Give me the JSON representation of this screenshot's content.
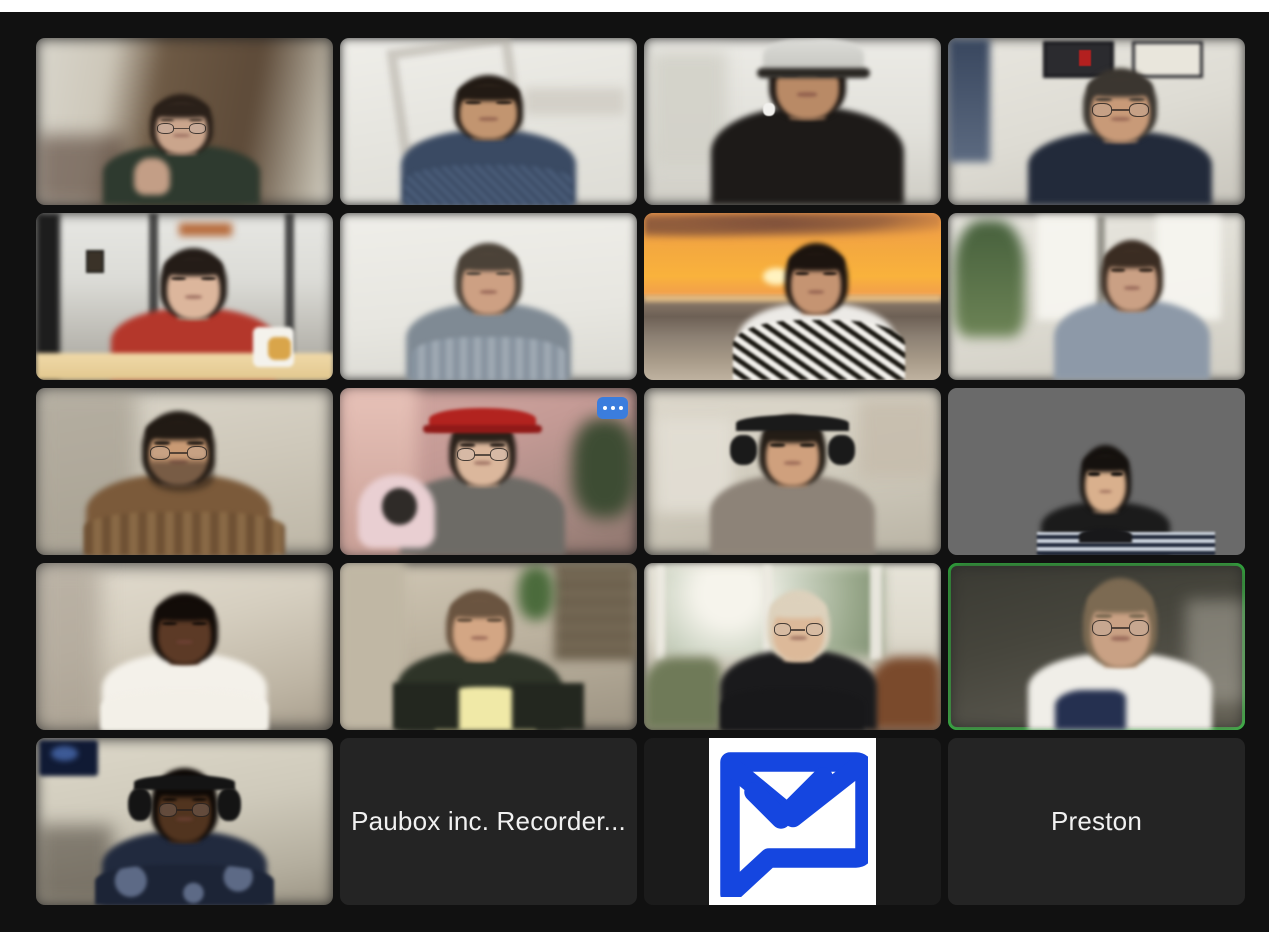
{
  "app": {
    "title": "Video Meeting Gallery View",
    "background_color": "#111111",
    "tile_color": "#242424",
    "active_speaker_color": "#22e03c",
    "brand_blue": "#1546e0",
    "more_button_color": "#3b7ddd"
  },
  "controls": {
    "more_options_label": "More options",
    "more_options_icon": "ellipsis-horizontal-icon"
  },
  "logo": {
    "name": "paubox-logo",
    "alt": "Paubox envelope checkmark logo",
    "color": "#1546e0",
    "background": "#ffffff"
  },
  "grid": {
    "columns": 4,
    "rows": 5,
    "tiles": [
      {
        "id": "p1",
        "type": "video",
        "name": "participant-tile-1",
        "label": "",
        "scene": "woman-glasses-brick-wall",
        "active": false,
        "more_menu": false
      },
      {
        "id": "p2",
        "type": "video",
        "name": "participant-tile-2",
        "label": "",
        "scene": "man-patterned-shirt-white-room",
        "active": false,
        "more_menu": false
      },
      {
        "id": "p3",
        "type": "video",
        "name": "participant-tile-3",
        "label": "",
        "scene": "man-cap-earbuds-bright-room",
        "active": false,
        "more_menu": false
      },
      {
        "id": "p4",
        "type": "video",
        "name": "participant-tile-4",
        "label": "",
        "scene": "man-glasses-home-office-frames",
        "active": false,
        "more_menu": false
      },
      {
        "id": "p5",
        "type": "video",
        "name": "participant-tile-5",
        "label": "",
        "scene": "man-red-shirt-open-office-mug",
        "active": false,
        "more_menu": false
      },
      {
        "id": "p6",
        "type": "video",
        "name": "participant-tile-6",
        "label": "",
        "scene": "man-checked-shirt-white-wall",
        "active": false,
        "more_menu": false
      },
      {
        "id": "p7",
        "type": "video",
        "name": "participant-tile-7",
        "label": "",
        "scene": "woman-sunset-beach-background",
        "active": false,
        "more_menu": false
      },
      {
        "id": "p8",
        "type": "video",
        "name": "participant-tile-8",
        "label": "",
        "scene": "woman-sunroom-plants-window",
        "active": false,
        "more_menu": false
      },
      {
        "id": "p9",
        "type": "video",
        "name": "participant-tile-9",
        "label": "",
        "scene": "man-glasses-beard-plaid-shirt",
        "active": false,
        "more_menu": false
      },
      {
        "id": "p10",
        "type": "video",
        "name": "participant-tile-10",
        "label": "",
        "scene": "man-red-cap-microphone-pink-wall",
        "active": false,
        "more_menu": true
      },
      {
        "id": "p11",
        "type": "video",
        "name": "participant-tile-11",
        "label": "",
        "scene": "man-headphones-living-room",
        "active": false,
        "more_menu": false
      },
      {
        "id": "p12",
        "type": "video",
        "name": "participant-tile-12",
        "label": "",
        "scene": "woman-striped-top-gray-backdrop",
        "active": false,
        "more_menu": false
      },
      {
        "id": "p13",
        "type": "video",
        "name": "participant-tile-13",
        "label": "",
        "scene": "man-white-tee-warm-room",
        "active": false,
        "more_menu": false
      },
      {
        "id": "p14",
        "type": "video",
        "name": "participant-tile-14",
        "label": "",
        "scene": "man-yellow-shirt-bookshelf",
        "active": false,
        "more_menu": false
      },
      {
        "id": "p15",
        "type": "video",
        "name": "participant-tile-15",
        "label": "",
        "scene": "woman-glasses-garden-window",
        "active": false,
        "more_menu": false
      },
      {
        "id": "p16",
        "type": "video",
        "name": "participant-tile-16",
        "label": "",
        "scene": "woman-glasses-dark-room-speaking",
        "active": true,
        "more_menu": false
      },
      {
        "id": "p17",
        "type": "video",
        "name": "participant-tile-17",
        "label": "",
        "scene": "man-headset-glasses-floral-shirt",
        "active": false,
        "more_menu": false
      },
      {
        "id": "p18",
        "type": "placeholder",
        "name": "recorder-tile",
        "label": "Paubox inc. Recorder...",
        "scene": "",
        "active": false,
        "more_menu": false
      },
      {
        "id": "p19",
        "type": "logo",
        "name": "paubox-logo-tile",
        "label": "",
        "scene": "",
        "active": false,
        "more_menu": false
      },
      {
        "id": "p20",
        "type": "placeholder",
        "name": "participant-tile-preston",
        "label": "Preston",
        "scene": "",
        "active": false,
        "more_menu": false
      }
    ]
  }
}
